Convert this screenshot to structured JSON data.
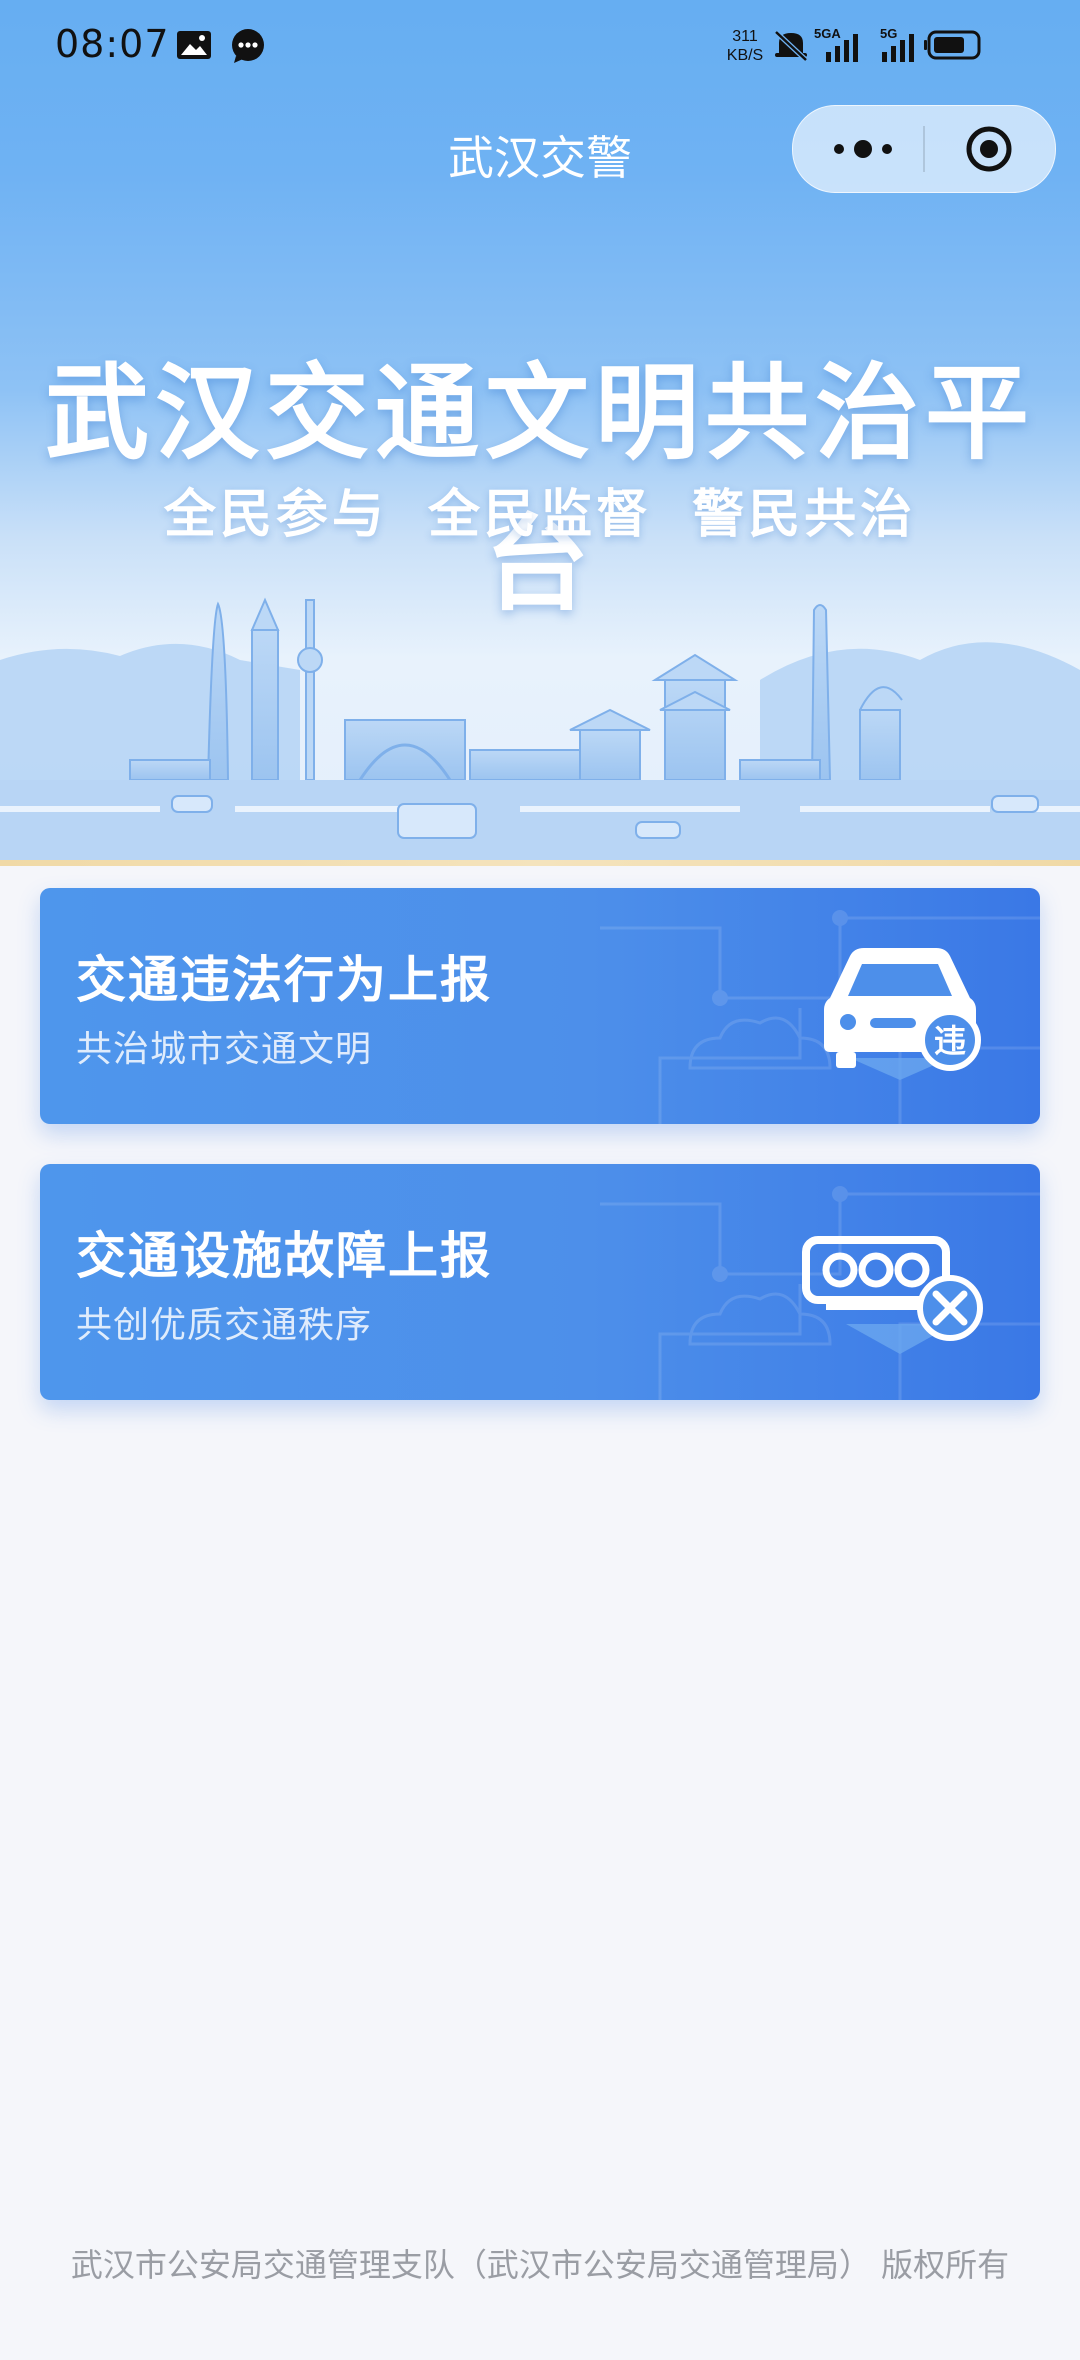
{
  "status_bar": {
    "time": "08:07",
    "network_speed_value": "311",
    "network_speed_unit": "KB/S",
    "signal_label_1": "5GA",
    "signal_label_2": "5G",
    "battery": "58",
    "icons": [
      "gallery-icon",
      "message-icon",
      "mute-icon",
      "signal-icon",
      "battery-icon"
    ]
  },
  "nav": {
    "title": "武汉交警",
    "icons": [
      "more-icon",
      "close-target-icon"
    ]
  },
  "hero": {
    "title": "武汉交通文明共治平台",
    "subtitle": "全民参与 全民监督 警民共治"
  },
  "cards": [
    {
      "title": "交通违法行为上报",
      "subtitle": "共治城市交通文明",
      "icon": "car-violation-icon",
      "badge": "违"
    },
    {
      "title": "交通设施故障上报",
      "subtitle": "共创优质交通秩序",
      "icon": "traffic-light-repair-icon"
    }
  ],
  "footer": {
    "copyright": "武汉市公安局交通管理支队（武汉市公安局交通管理局） 版权所有"
  },
  "colors": {
    "header_blue": "#66aef2",
    "card_blue": "#4d8fea",
    "page_background": "#f5f6fa",
    "footer_text": "#9a9da4"
  }
}
